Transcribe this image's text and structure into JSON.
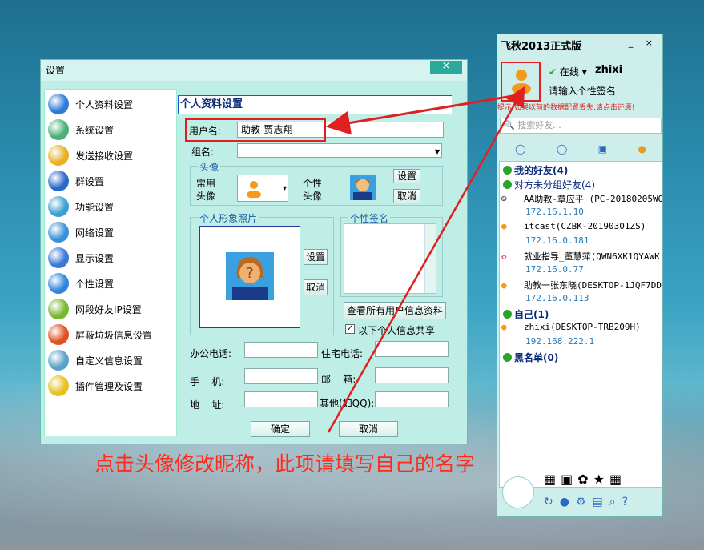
{
  "settings_window": {
    "title": "设置",
    "close": "×",
    "nav": [
      {
        "label": "个人资料设置",
        "color": "#2f7ad8"
      },
      {
        "label": "系统设置",
        "color": "#4ab07a"
      },
      {
        "label": "发送接收设置",
        "color": "#e8b020"
      },
      {
        "label": "群设置",
        "color": "#2a68c8"
      },
      {
        "label": "功能设置",
        "color": "#3aa0d0"
      },
      {
        "label": "网络设置",
        "color": "#3a90d8"
      },
      {
        "label": "显示设置",
        "color": "#3a78d8"
      },
      {
        "label": "个性设置",
        "color": "#2f84e0"
      },
      {
        "label": "网段好友IP设置",
        "color": "#78b830"
      },
      {
        "label": "屏蔽垃圾信息设置",
        "color": "#e05020"
      },
      {
        "label": "自定义信息设置",
        "color": "#5aa0c8"
      },
      {
        "label": "插件管理及设置",
        "color": "#e8c020"
      }
    ],
    "panel_title": "个人资料设置",
    "username_label": "用户名:",
    "username_value": "助教-贾志翔",
    "group_label": "组名:",
    "avatar_group": "头像",
    "common_avatar_label": "常用\n头像",
    "personal_avatar_label": "个性\n头像",
    "set_button": "设置",
    "cancel_button": "取消",
    "photo_group": "个人形象照片",
    "signature_group": "个性签名",
    "photo_set": "设置",
    "photo_cancel": "取消",
    "view_all_button": "查看所有用户信息资料",
    "share_checkbox": "以下个人信息共享",
    "office_phone": "办公电话:",
    "home_phone": "住宅电话:",
    "mobile": "手    机:",
    "email": "邮    箱:",
    "address": "地    址:",
    "other": "其他(如QQ):",
    "ok": "确定",
    "cancel": "取消"
  },
  "annotation": "点击头像修改昵称，此项请填写自己的名字",
  "qq": {
    "title": "飞秋2013正式版",
    "status": "在线",
    "nickname": "zhixi",
    "signature_placeholder": "请输入个性签名",
    "warning": "提示:如果以前的数据配置丢失,请点击还原!",
    "search_placeholder": "搜索好友...",
    "groups": [
      {
        "title": "我的好友(4)"
      },
      {
        "title": "对方未分组好友(4)"
      }
    ],
    "contacts": [
      {
        "name": "AA助教-章应平 (PC-20180205WO",
        "ip": "172.16.1.10"
      },
      {
        "name": "itcast(CZBK-20190301ZS)",
        "ip": "172.16.0.181"
      },
      {
        "name": "就业指导_董慧萍(QWN6XK1QYAWK",
        "ip": "172.16.0.77"
      },
      {
        "name": "助教一张东晓(DESKTOP-1JQF7DD",
        "ip": "172.16.0.113"
      }
    ],
    "self_group": "自己(1)",
    "self": {
      "name": "zhixi(DESKTOP-TRB209H)",
      "ip": "192.168.222.1"
    },
    "blacklist": "黑名单(0)"
  }
}
